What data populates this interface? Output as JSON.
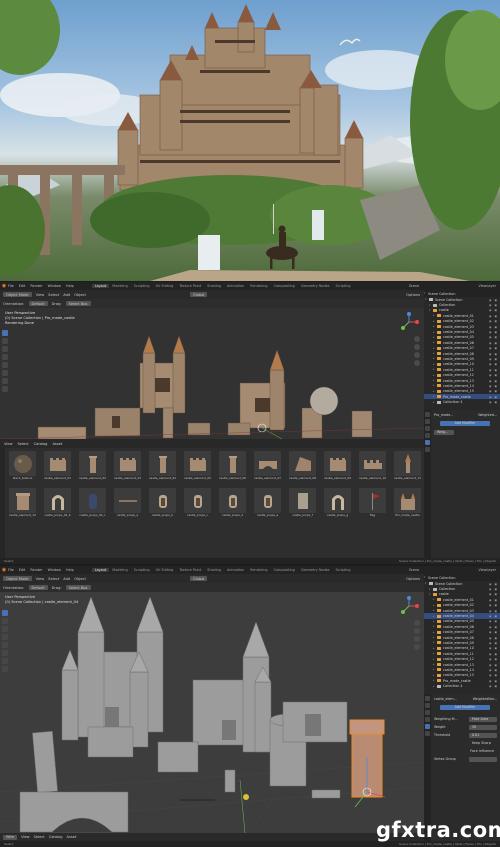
{
  "colors": {
    "blender_bg": "#303030",
    "viewport": "#3a3a3a",
    "accent_blue": "#4772b3",
    "selection_orange": "#f08a24",
    "sky": "#6e9fce"
  },
  "top_bar": {
    "menus": [
      "File",
      "Edit",
      "Render",
      "Window",
      "Help"
    ],
    "workspaces": [
      "Layout",
      "Modeling",
      "Sculpting",
      "UV Editing",
      "Texture Paint",
      "Shading",
      "Animation",
      "Rendering",
      "Compositing",
      "Geometry Nodes",
      "Scripting"
    ],
    "active_workspace": "Layout",
    "scene": "Scene",
    "view_layer": "ViewLayer"
  },
  "viewport_header": {
    "mode": "Object Mode",
    "menus": [
      "View",
      "Select",
      "Add",
      "Object"
    ],
    "orientation": "Global",
    "options": "Options"
  },
  "sub_header": {
    "orientation_label": "Orientation:",
    "orientation_value": "Default",
    "drag_label": "Drag:",
    "drag_value": "Select Box"
  },
  "panel2": {
    "viewport_info": [
      "User Perspective",
      "(0) Scene Collection | Pro_made_castle",
      "Rendering Done"
    ]
  },
  "panel3": {
    "viewport_info": [
      "User Perspective",
      "(0) Scene Collection | castle_element_04"
    ],
    "search": "Wire"
  },
  "outliner": {
    "header": "Scene Collection",
    "rows": [
      "Scene Collection",
      "Collection",
      "castle",
      "castle_element_01",
      "castle_element_02",
      "castle_element_03",
      "castle_element_04",
      "castle_element_05",
      "castle_element_06",
      "castle_element_07",
      "castle_element_08",
      "castle_element_09",
      "castle_element_10",
      "castle_element_11",
      "castle_element_12",
      "castle_element_13",
      "castle_element_14",
      "castle_element_15",
      "Pro_made_castle",
      "Collection 4"
    ]
  },
  "properties_p2": {
    "object": "Pro_made...",
    "modifier": "Weighted...",
    "add_modifier": "Add Modifier",
    "mod_name": "Weig..."
  },
  "properties_p3": {
    "object": "castle_elem...",
    "modifier": "WeightedNor...",
    "add_modifier": "Add Modifier",
    "rows": [
      {
        "label": "Weighting M...",
        "value": "Face Area"
      },
      {
        "label": "Weight",
        "value": "50"
      },
      {
        "label": "Threshold",
        "value": "0.01"
      },
      {
        "label": "",
        "value": "Keep Sharp"
      },
      {
        "label": "",
        "value": "Face Influence"
      },
      {
        "label": "Vertex Group",
        "value": ""
      }
    ]
  },
  "asset_browser": {
    "menus": [
      "View",
      "Select",
      "Catalog",
      "Asset"
    ],
    "items": [
      {
        "label": "black_texture",
        "icon": "sphere"
      },
      {
        "label": "castle_element_01",
        "icon": "wall"
      },
      {
        "label": "castle_element_02",
        "icon": "pillar"
      },
      {
        "label": "castle_element_03",
        "icon": "wall"
      },
      {
        "label": "castle_element_04",
        "icon": "pillar"
      },
      {
        "label": "castle_element_05",
        "icon": "wall"
      },
      {
        "label": "castle_element_06",
        "icon": "pillar"
      },
      {
        "label": "castle_element_07",
        "icon": "bridge"
      },
      {
        "label": "castle_element_08",
        "icon": "ramp"
      },
      {
        "label": "castle_element_09",
        "icon": "wall"
      },
      {
        "label": "castle_element_10",
        "icon": "battlement"
      },
      {
        "label": "castle_element_11",
        "icon": "spire"
      },
      {
        "label": "castle_element_12",
        "icon": "tower"
      },
      {
        "label": "castle_props_04_b",
        "icon": "arch"
      },
      {
        "label": "castle_props_04_c",
        "icon": "door"
      },
      {
        "label": "castle_props_a",
        "icon": "beam"
      },
      {
        "label": "castle_props_b",
        "icon": "window"
      },
      {
        "label": "castle_props_c",
        "icon": "window"
      },
      {
        "label": "castle_props_d",
        "icon": "window"
      },
      {
        "label": "castle_props_e",
        "icon": "window"
      },
      {
        "label": "castle_props_f",
        "icon": "panel"
      },
      {
        "label": "castle_props_g",
        "icon": "arch"
      },
      {
        "label": "flag",
        "icon": "flag"
      },
      {
        "label": "Pro_made_castle",
        "icon": "castle"
      }
    ]
  },
  "status_bar": {
    "left": "Select",
    "right": "Scene Collection | Pro_made_castle | Verts | Faces | Tris | Objects"
  },
  "watermark": "gfxtra.com"
}
